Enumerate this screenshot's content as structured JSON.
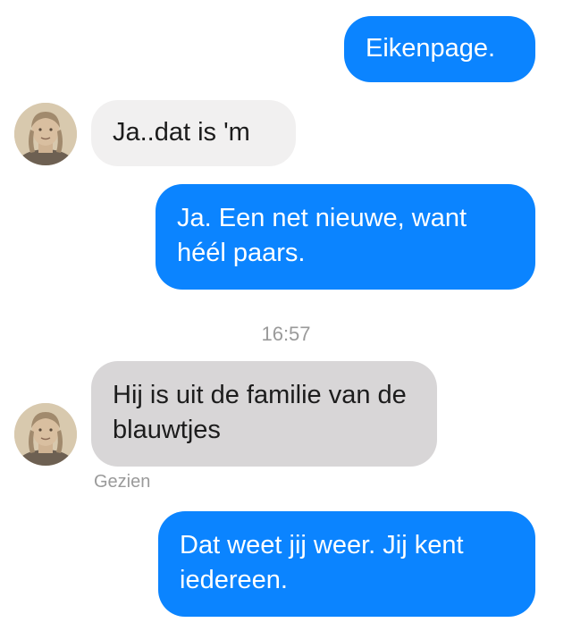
{
  "conversation": {
    "messages": [
      {
        "direction": "outgoing",
        "text": "Eikenpage."
      },
      {
        "direction": "incoming",
        "text": "Ja..dat is 'm"
      },
      {
        "direction": "outgoing",
        "text": "Ja. Een net nieuwe, want héél paars."
      },
      {
        "direction": "incoming",
        "text": "Hij is uit de familie van de blauwtjes"
      },
      {
        "direction": "outgoing",
        "text": "Dat weet jij weer. Jij kent iedereen."
      }
    ],
    "timestamp": "16:57",
    "seen_label": "Gezien"
  },
  "colors": {
    "outgoing_bubble": "#0b84ff",
    "incoming_bubble_light": "#f1f0f0",
    "incoming_bubble_selected": "#d8d6d7",
    "meta_text": "#9a9a9a"
  },
  "icons": {
    "avatar": "contact-avatar-photo"
  }
}
